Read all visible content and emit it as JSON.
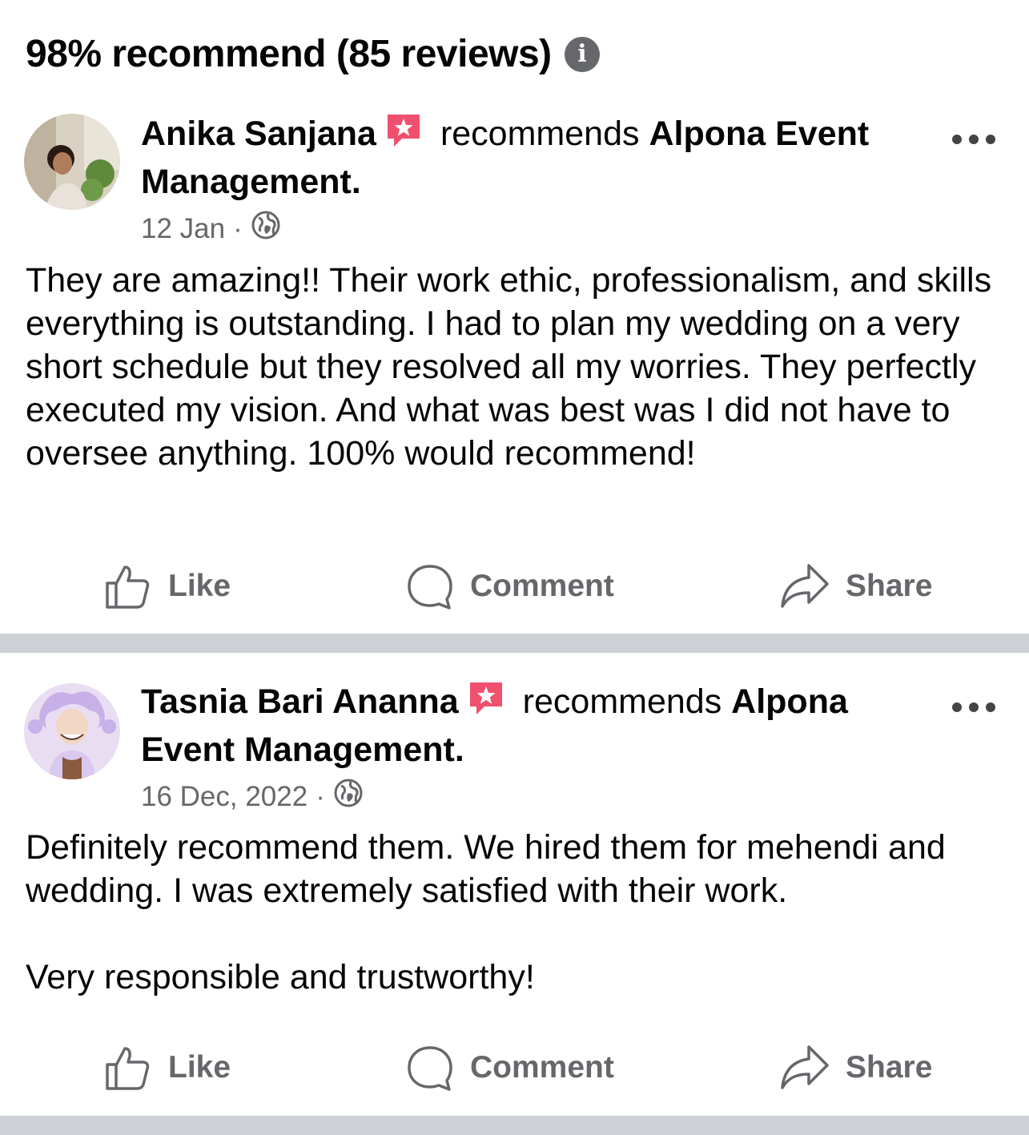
{
  "header": {
    "summary": "98% recommend (85 reviews)",
    "info_icon": "i"
  },
  "reviews": [
    {
      "reviewer": "Anika Sanjana",
      "verb": "recommends",
      "page_name": "Alpona Event Management.",
      "date": "12 Jan",
      "separator": "·",
      "audience_icon": "globe-icon",
      "text": "They are amazing!! Their work ethic, professionalism, and skills everything is outstanding. I had to plan my wedding on a very short schedule but they resolved all my worries. They perfectly executed my vision. And what was best was I did not have to oversee anything. 100% would recommend!"
    },
    {
      "reviewer": "Tasnia Bari Ananna",
      "verb": "recommends",
      "page_name": "Alpona Event Management.",
      "date": "16 Dec, 2022",
      "separator": "·",
      "audience_icon": "globe-icon",
      "text": "Definitely recommend them. We hired them for mehendi and wedding. I was extremely satisfied with their work.\n\nVery responsible and trustworthy!"
    }
  ],
  "actions": {
    "like": "Like",
    "comment": "Comment",
    "share": "Share"
  },
  "colors": {
    "badge": "#f0506e",
    "secondary_text": "#65676b",
    "divider": "#cdd0d4"
  }
}
